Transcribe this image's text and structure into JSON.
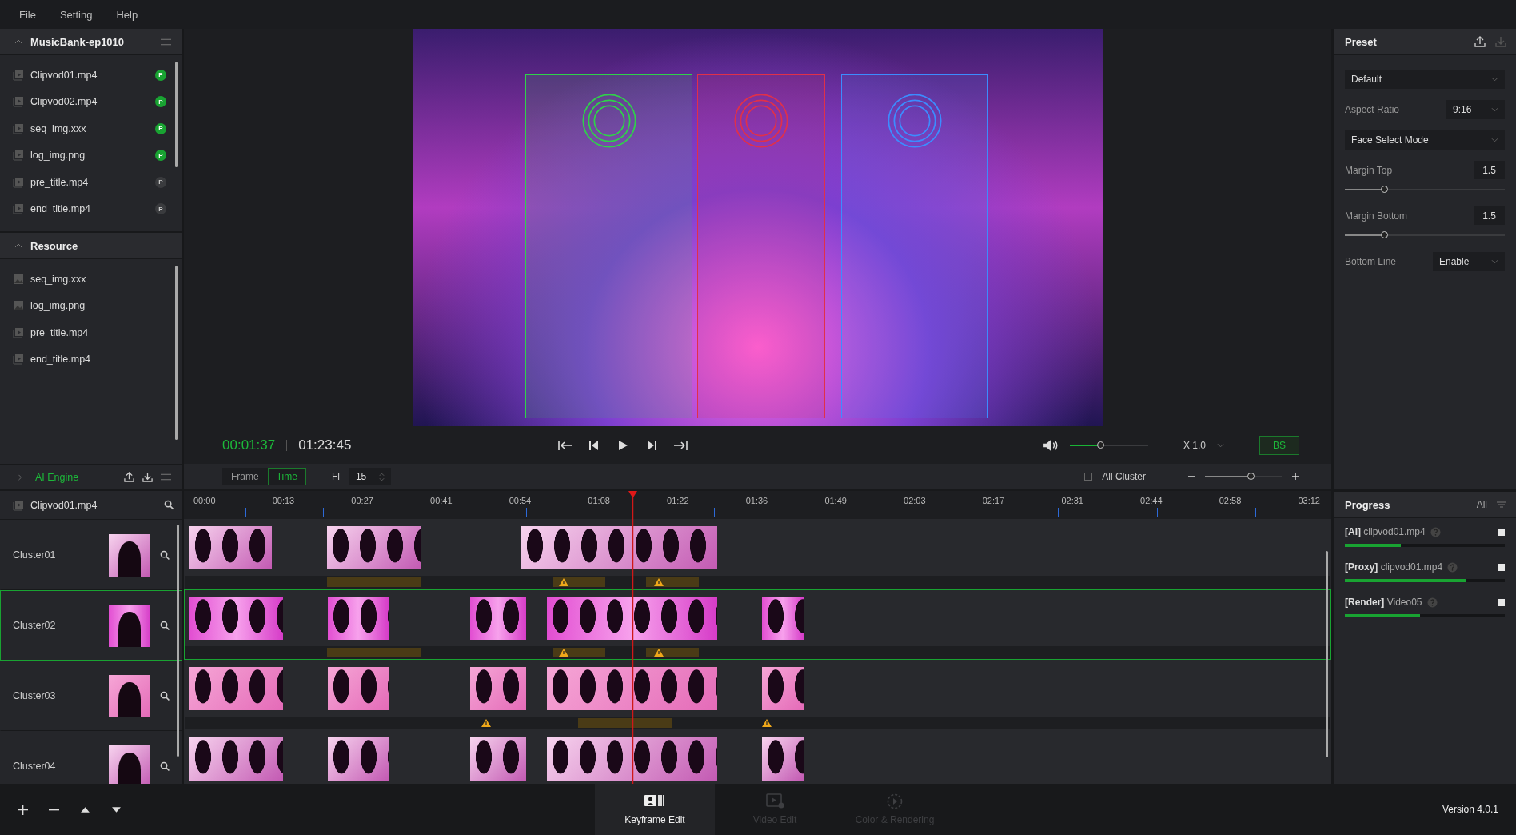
{
  "menu": [
    "File",
    "Setting",
    "Help"
  ],
  "project": {
    "title": "MusicBank-ep1010",
    "items": [
      {
        "name": "Clipvod01.mp4",
        "ready": true,
        "badge": "P"
      },
      {
        "name": "Clipvod02.mp4",
        "ready": true,
        "badge": "P"
      },
      {
        "name": "seq_img.xxx",
        "ready": true,
        "badge": "P"
      },
      {
        "name": "log_img.png",
        "ready": true,
        "badge": "P"
      },
      {
        "name": "pre_title.mp4",
        "ready": false,
        "badge": "P"
      },
      {
        "name": "end_title.mp4",
        "ready": false,
        "badge": "P"
      }
    ]
  },
  "resource": {
    "title": "Resource",
    "items": [
      {
        "name": "seq_img.xxx",
        "kind": "image"
      },
      {
        "name": "log_img.png",
        "kind": "image"
      },
      {
        "name": "pre_title.mp4",
        "kind": "video"
      },
      {
        "name": "end_title.mp4",
        "kind": "video"
      }
    ]
  },
  "ai_engine": {
    "title": "AI Engine"
  },
  "preview": {
    "face_boxes": [
      {
        "color": "#2fd14a"
      },
      {
        "color": "#e0304a"
      },
      {
        "color": "#3c8cff"
      }
    ]
  },
  "transport": {
    "current": "00:01:37",
    "total": "01:23:45",
    "volume": {
      "level": 0.4
    },
    "speed": "X 1.0",
    "bs": "BS"
  },
  "timeline_toolbar": {
    "modes": [
      {
        "label": "Frame",
        "selected": false
      },
      {
        "label": "Time",
        "selected": true
      }
    ],
    "fl_label": "Fl",
    "fl_value": "15",
    "all_cluster": {
      "label": "All Cluster",
      "checked": false
    },
    "zoom": {
      "level": 0.6
    }
  },
  "track_header": {
    "name": "Clipvod01.mp4"
  },
  "ruler": [
    "00:00",
    "00:13",
    "00:27",
    "00:41",
    "00:54",
    "01:08",
    "01:22",
    "01:36",
    "01:49",
    "02:03",
    "02:17",
    "02:31",
    "02:44",
    "02:58",
    "03:12"
  ],
  "clusters": [
    {
      "name": "Cluster01",
      "selected": false
    },
    {
      "name": "Cluster02",
      "selected": true
    },
    {
      "name": "Cluster03",
      "selected": false
    },
    {
      "name": "Cluster04",
      "selected": false
    }
  ],
  "preset": {
    "title": "Preset",
    "preset_value": "Default",
    "aspect_label": "Aspect Ratio",
    "aspect_value": "9:16",
    "mode_value": "Face Select Mode",
    "margins": [
      {
        "label": "Margin Top",
        "value": "1.5",
        "level": 0.25
      },
      {
        "label": "Margin Bottom",
        "value": "1.5",
        "level": 0.25
      }
    ],
    "bottom_label": "Bottom Line",
    "bottom_value": "Enable"
  },
  "progress": {
    "title": "Progress",
    "filter": "All",
    "tasks": [
      {
        "tag": "[AI]",
        "name": "clipvod01.mp4",
        "level": 0.35
      },
      {
        "tag": "[Proxy]",
        "name": "clipvod01.mp4",
        "level": 0.76
      },
      {
        "tag": "[Render]",
        "name": "Video05",
        "level": 0.47
      }
    ]
  },
  "modes": [
    {
      "label": "Keyframe Edit",
      "kind": "keyframe",
      "selected": true
    },
    {
      "label": "Video Edit",
      "kind": "video",
      "selected": false
    },
    {
      "label": "Color & Rendering",
      "kind": "color",
      "selected": false
    }
  ],
  "version": "Version 4.0.1"
}
